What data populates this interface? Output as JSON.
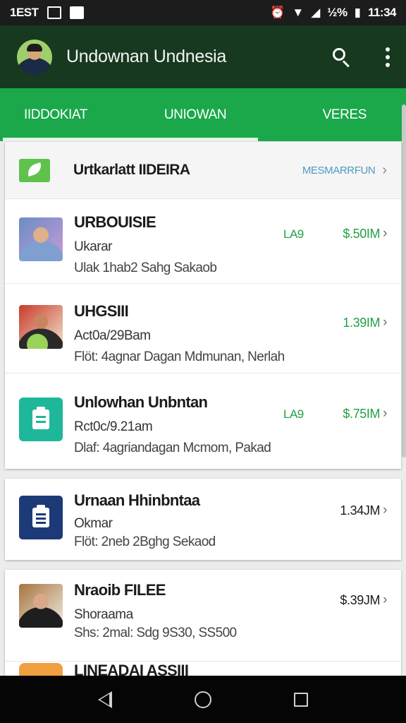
{
  "status_bar": {
    "carrier_text": "1EST",
    "signal_text": "½%",
    "time": "11:34",
    "icons": [
      "image-notification-icon",
      "mail-notification-icon",
      "alarm-icon",
      "wifi-icon",
      "signal-icon",
      "battery-icon"
    ]
  },
  "app_bar": {
    "title": "Undownan Undnesia",
    "icons": [
      "avatar",
      "search-icon",
      "more-vert-icon"
    ]
  },
  "tabs": [
    {
      "label": "IIDDOKIAT",
      "active": false
    },
    {
      "label": "UNIOWAN",
      "active": true
    },
    {
      "label": "VERES",
      "active": false
    }
  ],
  "section_header": {
    "title": "Urtkarlatt IIDEIRA",
    "link": "MESMARRFUN"
  },
  "list": [
    {
      "title": "URBOUISIE",
      "subtitle": "Ukarar",
      "meta": "Ulak 1hab2 Sahg Sakaob",
      "tag": "LA9",
      "price": "$.50IM",
      "price_color": "green"
    },
    {
      "title": "UHGSIII",
      "subtitle": "Act0a/29Bam",
      "meta": "Flöt: 4agnar Dagan Mdmunan, Nerlah",
      "tag": "",
      "price": "1.39IM",
      "price_color": "green"
    },
    {
      "title": "Unlowhan Unbntan",
      "subtitle": "Rct0c/9.21am",
      "meta": "Dlaf: 4agriandagan Mcmom, Pakad",
      "tag": "LA9",
      "price": "$.75IM",
      "price_color": "green"
    },
    {
      "title": "Urnaan Hhinbntaa",
      "subtitle": "Okmar",
      "meta": "Flöt: 2neb 2Bghg Sekaod",
      "tag": "",
      "price": "1.34JM",
      "price_color": "dark"
    },
    {
      "title": "Nraoib FILEE",
      "subtitle": "Shoraama",
      "meta": "Shs: 2mal: Sdg 9S30, SS500",
      "tag": "",
      "price": "$.39JM",
      "price_color": "dark"
    },
    {
      "title": "LINEADAI ASSIII",
      "subtitle": "",
      "meta": "",
      "tag": "",
      "price": "",
      "price_color": "dark"
    }
  ],
  "colors": {
    "app_bar": "#17391f",
    "tab_bar": "#1aa84a",
    "accent_green": "#20a243",
    "link_blue": "#4e9cbf"
  },
  "nav_bar": {
    "icons": [
      "back-icon",
      "home-icon",
      "recents-icon"
    ]
  }
}
